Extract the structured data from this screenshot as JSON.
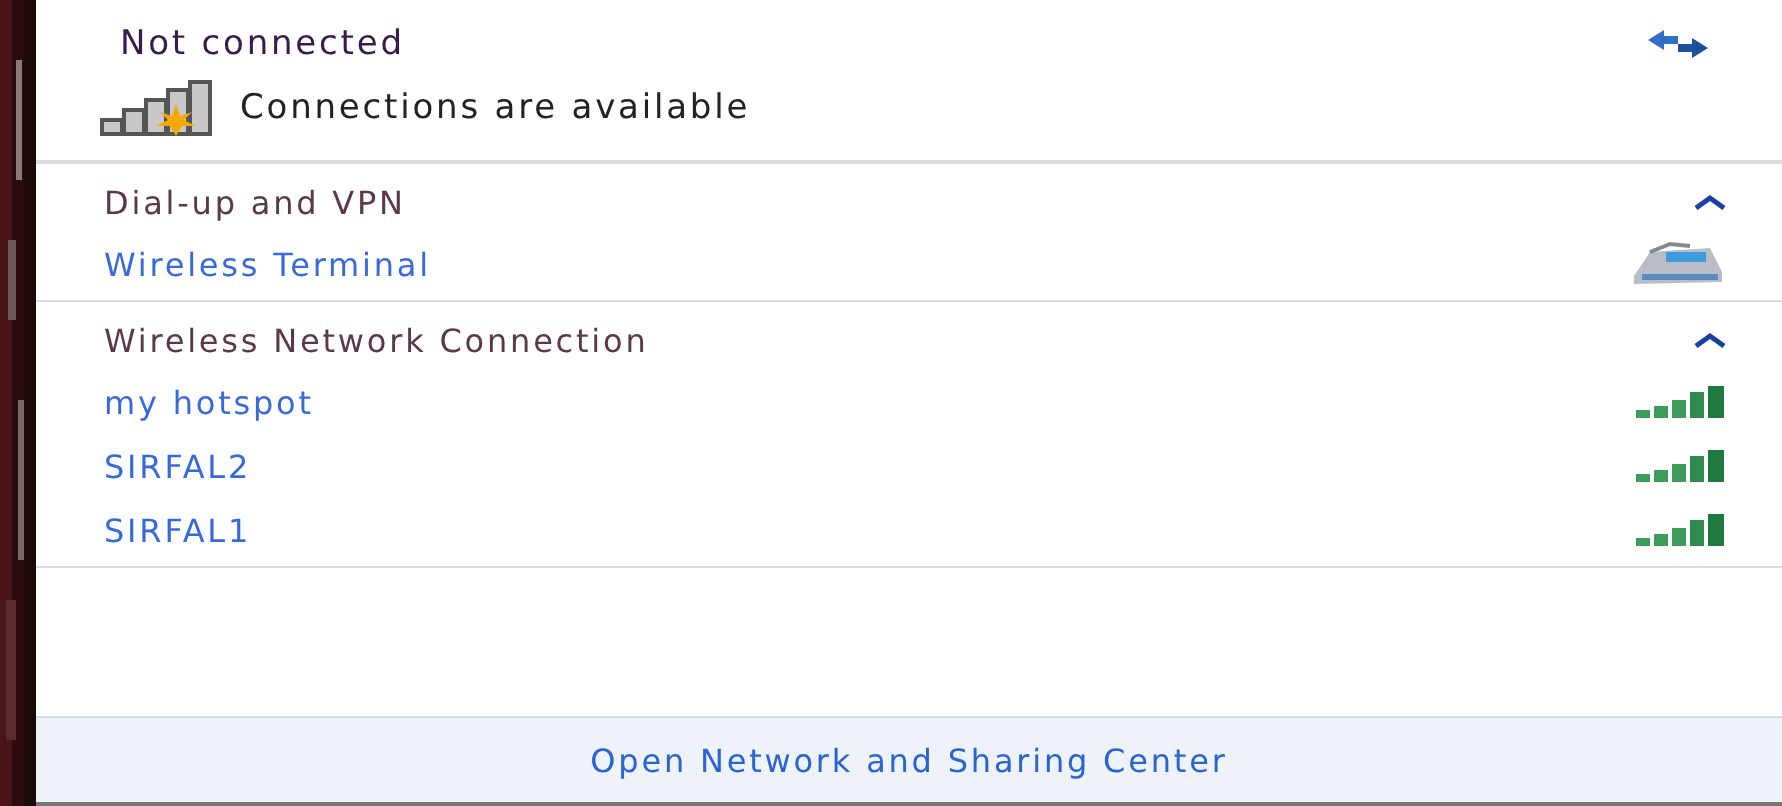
{
  "status": {
    "title": "Not connected",
    "message": "Connections are available"
  },
  "sections": [
    {
      "title": "Dial-up and VPN",
      "expanded": true,
      "items": [
        {
          "name": "Wireless Terminal",
          "kind": "dialup"
        }
      ]
    },
    {
      "title": "Wireless Network Connection",
      "expanded": true,
      "items": [
        {
          "name": "my hotspot",
          "kind": "wifi"
        },
        {
          "name": "SIRFAL2",
          "kind": "wifi"
        },
        {
          "name": "SIRFAL1",
          "kind": "wifi"
        }
      ]
    }
  ],
  "footer_link": "Open Network and Sharing Center"
}
